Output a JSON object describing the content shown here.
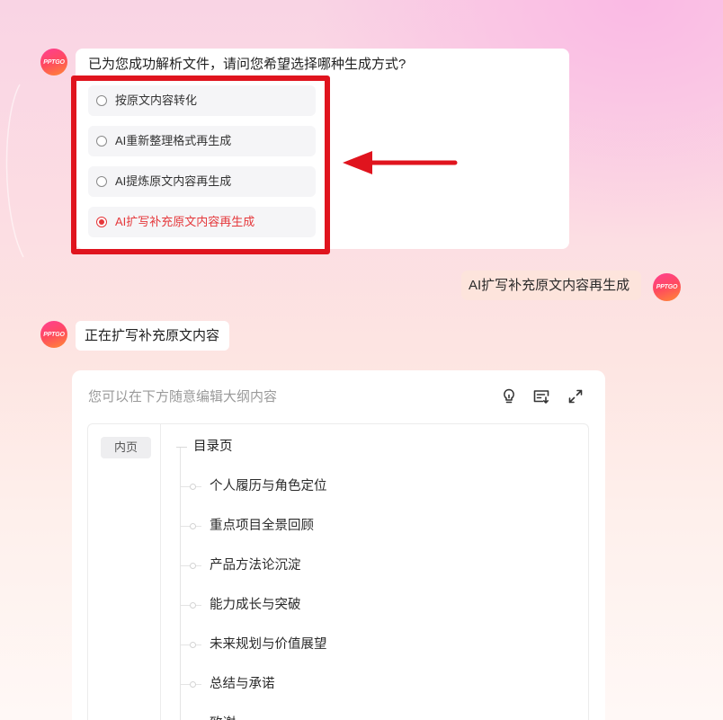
{
  "avatar": {
    "label": "PPTGO"
  },
  "chat": {
    "question": "已为您成功解析文件，请问您希望选择哪种生成方式?",
    "options": [
      {
        "label": "按原文内容转化",
        "selected": false
      },
      {
        "label": "AI重新整理格式再生成",
        "selected": false
      },
      {
        "label": "AI提炼原文内容再生成",
        "selected": false
      },
      {
        "label": "AI扩写补充原文内容再生成",
        "selected": true
      }
    ],
    "user_reply": "AI扩写补充原文内容再生成",
    "status": "正在扩写补充原文内容"
  },
  "outline": {
    "hint": "您可以在下方随意编辑大纲内容",
    "toolbar_icons": [
      "bulb-icon",
      "list-download-icon",
      "expand-icon"
    ],
    "page_tag": "内页",
    "root": "目录页",
    "items": [
      "个人履历与角色定位",
      "重点项目全景回顾",
      "产品方法论沉淀",
      "能力成长与突破",
      "未来规划与价值展望",
      "总结与承诺",
      "致谢"
    ]
  },
  "colors": {
    "selected_option": "#e5383b",
    "annotation": "#e0141e",
    "user_bubble": "#fde4dc"
  }
}
